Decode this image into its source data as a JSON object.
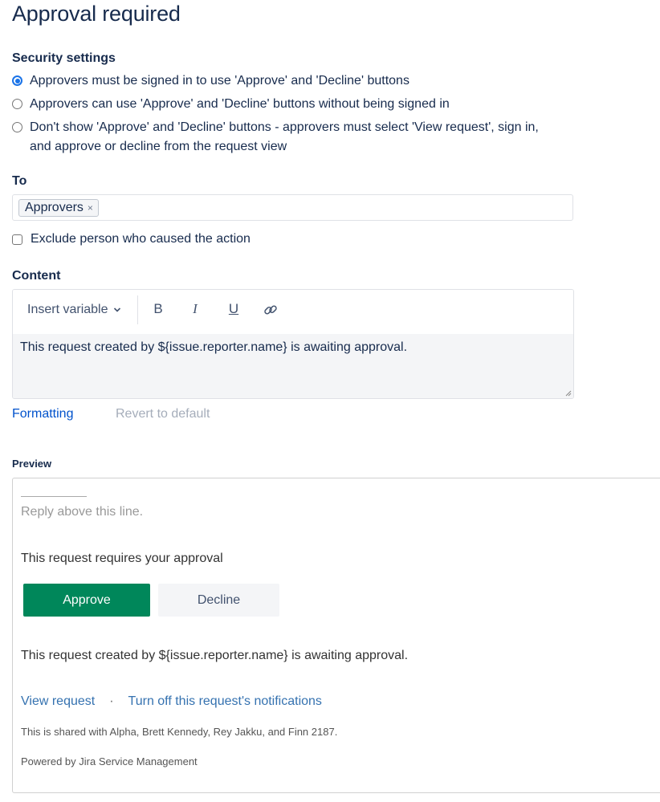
{
  "title": "Approval required",
  "security": {
    "label": "Security settings",
    "options": [
      {
        "label": "Approvers must be signed in to use 'Approve' and 'Decline' buttons",
        "selected": true
      },
      {
        "label": "Approvers can use 'Approve' and 'Decline' buttons without being signed in",
        "selected": false
      },
      {
        "label_line1": "Don't show 'Approve' and 'Decline' buttons - approvers must select 'View request', sign in,",
        "label_line2": "and approve or decline from the request view",
        "selected": false
      }
    ]
  },
  "to": {
    "label": "To",
    "chips": [
      {
        "label": "Approvers",
        "remove_icon": "×"
      }
    ]
  },
  "exclude": {
    "label": "Exclude person who caused the action",
    "checked": false
  },
  "content": {
    "label": "Content",
    "toolbar": {
      "insert_variable": "Insert variable",
      "chevron": "⌄",
      "bold": "B",
      "italic": "I",
      "underline": "U"
    },
    "body": "This request created by ${issue.reporter.name} is awaiting approval."
  },
  "links": {
    "formatting": "Formatting",
    "revert": "Revert to default"
  },
  "colors": {
    "link": "#0052cc",
    "disabled": "#a5adba",
    "approve": "#00875a",
    "radio": "#1a73e8"
  },
  "preview": {
    "label": "Preview",
    "reply_line": "Reply above this line.",
    "requires": "This request requires your approval",
    "approve": "Approve",
    "decline": "Decline",
    "body": "This request created by ${issue.reporter.name} is awaiting approval.",
    "view_request": "View request",
    "separator": "·",
    "turn_off": "Turn off this request's notifications",
    "shared": "This is shared with Alpha, Brett Kennedy, Rey Jakku, and Finn 2187.",
    "powered": "Powered by Jira Service Management"
  }
}
